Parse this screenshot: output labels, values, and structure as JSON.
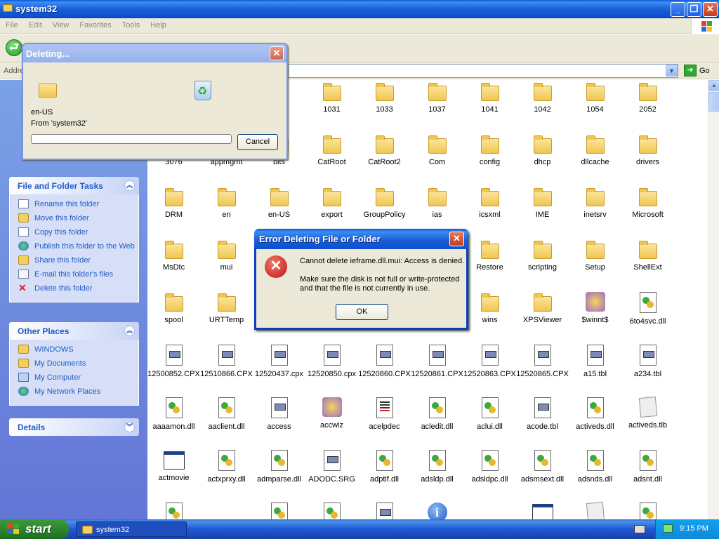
{
  "window": {
    "title": "system32"
  },
  "menu": [
    "File",
    "Edit",
    "View",
    "Favorites",
    "Tools",
    "Help"
  ],
  "address": {
    "label": "Addre",
    "go_label": "Go"
  },
  "sidebar": {
    "panels": [
      {
        "title": "File and Folder Tasks",
        "items": [
          {
            "label": "Rename this folder",
            "icon": "rename-icon"
          },
          {
            "label": "Move this folder",
            "icon": "move-icon"
          },
          {
            "label": "Copy this folder",
            "icon": "copy-icon"
          },
          {
            "label": "Publish this folder to the Web",
            "icon": "globe-icon"
          },
          {
            "label": "Share this folder",
            "icon": "share-icon"
          },
          {
            "label": "E-mail this folder's files",
            "icon": "email-icon"
          },
          {
            "label": "Delete this folder",
            "icon": "delete-icon"
          }
        ]
      },
      {
        "title": "Other Places",
        "items": [
          {
            "label": "WINDOWS",
            "icon": "folder-icon"
          },
          {
            "label": "My Documents",
            "icon": "my-documents-icon"
          },
          {
            "label": "My Computer",
            "icon": "my-computer-icon"
          },
          {
            "label": "My Network Places",
            "icon": "network-icon"
          }
        ]
      },
      {
        "title": "Details",
        "items": []
      }
    ]
  },
  "files": [
    {
      "name": "1031",
      "type": "folder"
    },
    {
      "name": "1033",
      "type": "folder"
    },
    {
      "name": "1037",
      "type": "folder"
    },
    {
      "name": "1041",
      "type": "folder"
    },
    {
      "name": "1042",
      "type": "folder"
    },
    {
      "name": "1054",
      "type": "folder"
    },
    {
      "name": "2052",
      "type": "folder"
    },
    {
      "name": "3076",
      "type": "folder"
    },
    {
      "name": "appmgmt",
      "type": "folder"
    },
    {
      "name": "bits",
      "type": "folder"
    },
    {
      "name": "CatRoot",
      "type": "folder"
    },
    {
      "name": "CatRoot2",
      "type": "folder"
    },
    {
      "name": "Com",
      "type": "folder"
    },
    {
      "name": "config",
      "type": "folder"
    },
    {
      "name": "dhcp",
      "type": "folder"
    },
    {
      "name": "dllcache",
      "type": "folder"
    },
    {
      "name": "drivers",
      "type": "folder"
    },
    {
      "name": "DRM",
      "type": "folder"
    },
    {
      "name": "en",
      "type": "folder"
    },
    {
      "name": "en-US",
      "type": "folder"
    },
    {
      "name": "export",
      "type": "folder"
    },
    {
      "name": "GroupPolicy",
      "type": "folder"
    },
    {
      "name": "ias",
      "type": "folder"
    },
    {
      "name": "icsxml",
      "type": "folder"
    },
    {
      "name": "IME",
      "type": "folder"
    },
    {
      "name": "inetsrv",
      "type": "folder"
    },
    {
      "name": "Microsoft",
      "type": "folder"
    },
    {
      "name": "MsDtc",
      "type": "folder"
    },
    {
      "name": "mui",
      "type": "folder"
    },
    {
      "name": "Restore",
      "type": "folder"
    },
    {
      "name": "scripting",
      "type": "folder"
    },
    {
      "name": "Setup",
      "type": "folder"
    },
    {
      "name": "ShellExt",
      "type": "folder"
    },
    {
      "name": "spool",
      "type": "folder"
    },
    {
      "name": "URTTemp",
      "type": "folder"
    },
    {
      "name": "wins",
      "type": "folder"
    },
    {
      "name": "XPSViewer",
      "type": "folder"
    },
    {
      "name": "$winnt$",
      "type": "tool"
    },
    {
      "name": "6to4svc.dll",
      "type": "dll"
    },
    {
      "name": "12500852.CPX",
      "type": "file"
    },
    {
      "name": "12510866.CPX",
      "type": "file"
    },
    {
      "name": "12520437.cpx",
      "type": "file"
    },
    {
      "name": "12520850.cpx",
      "type": "file"
    },
    {
      "name": "12520860.CPX",
      "type": "file"
    },
    {
      "name": "12520861.CPX",
      "type": "file"
    },
    {
      "name": "12520863.CPX",
      "type": "file"
    },
    {
      "name": "12520865.CPX",
      "type": "file"
    },
    {
      "name": "a15.tbl",
      "type": "file"
    },
    {
      "name": "a234.tbl",
      "type": "file"
    },
    {
      "name": "aaaamon.dll",
      "type": "dll"
    },
    {
      "name": "aaclient.dll",
      "type": "dll"
    },
    {
      "name": "access",
      "type": "file"
    },
    {
      "name": "accwiz",
      "type": "tool"
    },
    {
      "name": "acelpdec",
      "type": "doc"
    },
    {
      "name": "acledit.dll",
      "type": "dll"
    },
    {
      "name": "aclui.dll",
      "type": "dll"
    },
    {
      "name": "acode.tbl",
      "type": "file"
    },
    {
      "name": "activeds.dll",
      "type": "dll"
    },
    {
      "name": "activeds.tlb",
      "type": "tlb"
    },
    {
      "name": "actmovie",
      "type": "app"
    },
    {
      "name": "actxprxy.dll",
      "type": "dll"
    },
    {
      "name": "admparse.dll",
      "type": "dll"
    },
    {
      "name": "ADODC.SRG",
      "type": "file"
    },
    {
      "name": "adptif.dll",
      "type": "dll"
    },
    {
      "name": "adsldp.dll",
      "type": "dll"
    },
    {
      "name": "adsldpc.dll",
      "type": "dll"
    },
    {
      "name": "adsmsext.dll",
      "type": "dll"
    },
    {
      "name": "adsnds.dll",
      "type": "dll"
    },
    {
      "name": "adsnt.dll",
      "type": "dll"
    },
    {
      "name": "",
      "type": "dll"
    },
    {
      "name": "",
      "type": "dll"
    },
    {
      "name": "",
      "type": "dll"
    },
    {
      "name": "",
      "type": "file"
    },
    {
      "name": "",
      "type": "info"
    },
    {
      "name": "",
      "type": "app"
    },
    {
      "name": "",
      "type": "tlb"
    },
    {
      "name": "",
      "type": "dll"
    },
    {
      "name": "",
      "type": "file"
    }
  ],
  "delete_dialog": {
    "title": "Deleting...",
    "file_name": "en-US",
    "from_text": "From 'system32'",
    "progress": 0,
    "cancel_label": "Cancel"
  },
  "error_dialog": {
    "title": "Error Deleting File or Folder",
    "message": "Cannot delete ieframe.dll.mui: Access is denied.",
    "detail": "Make sure the disk is not full or write-protected and that the file is not currently in use.",
    "ok_label": "OK"
  },
  "taskbar": {
    "start_label": "start",
    "task_label": "system32",
    "clock": "9:15 PM"
  },
  "colors": {
    "xp_blue": "#0a5ad8",
    "sidebar_link": "#215dc6",
    "start_green": "#2d862d"
  }
}
